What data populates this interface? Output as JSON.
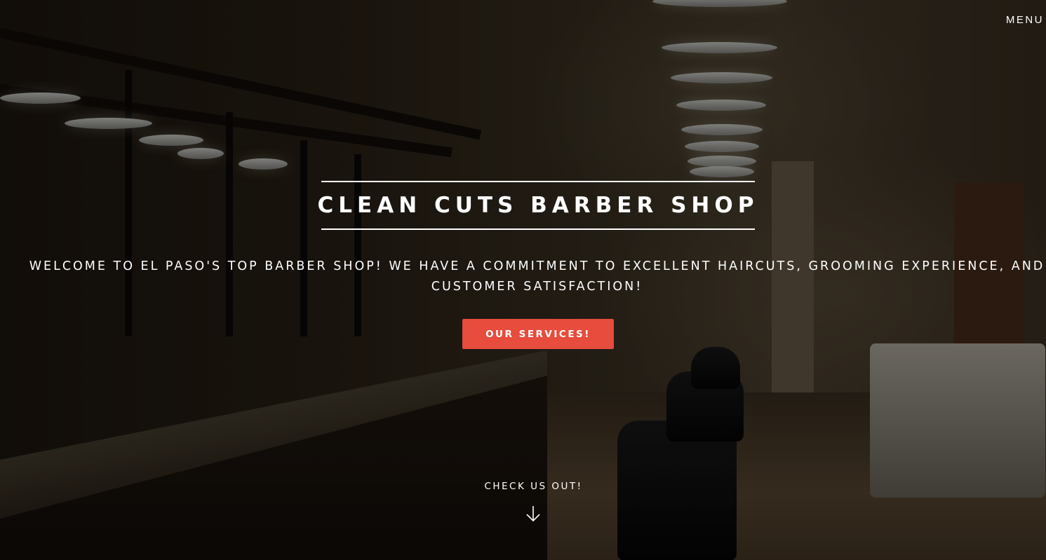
{
  "nav": {
    "menu_label": "MENU"
  },
  "hero": {
    "title": "CLEAN CUTS BARBER SHOP",
    "subtitle": "WELCOME TO EL PASO'S TOP BARBER SHOP! WE HAVE A COMMITMENT TO EXCELLENT HAIRCUTS, GROOMING EXPERIENCE, AND CUSTOMER SATISFACTION!",
    "cta_label": "OUR SERVICES!",
    "scroll_label": "CHECK US OUT!",
    "scroll_icon": "arrow-down-icon",
    "background_image": "barber-shop-interior-photo"
  },
  "colors": {
    "accent": "#e74c3c",
    "text": "#ffffff"
  }
}
